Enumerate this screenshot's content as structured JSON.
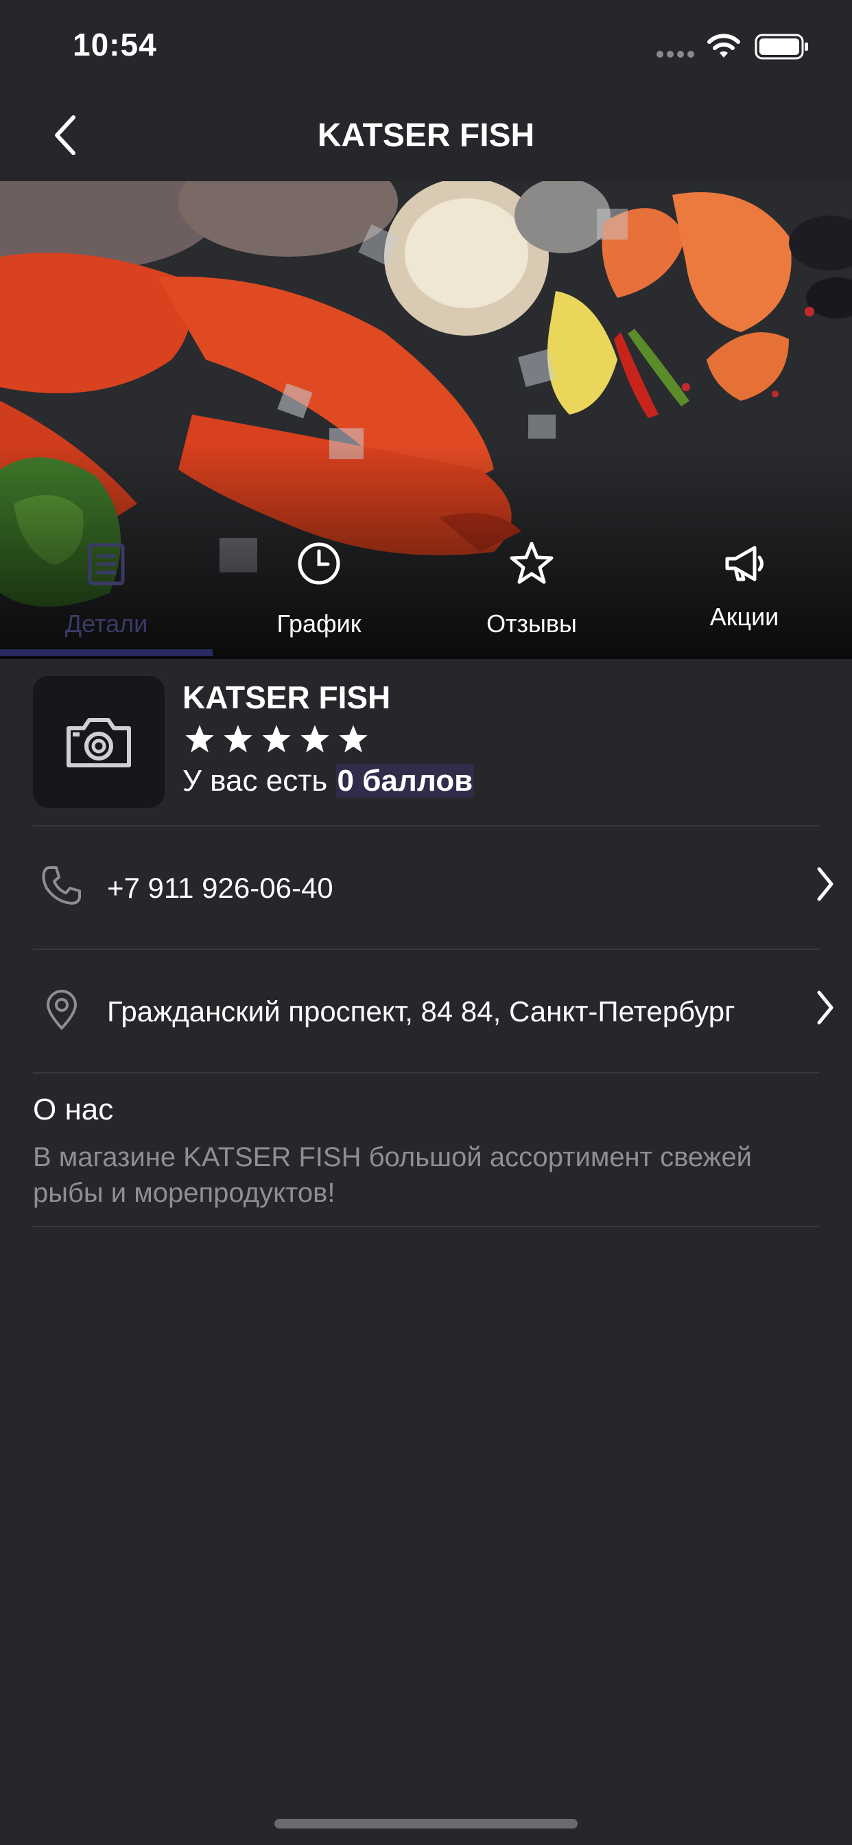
{
  "status_bar": {
    "time": "10:54"
  },
  "nav": {
    "title": "KATSER FISH"
  },
  "tabs": [
    {
      "label": "Детали",
      "icon": "details-icon",
      "active": true
    },
    {
      "label": "График",
      "icon": "clock-icon",
      "active": false
    },
    {
      "label": "Отзывы",
      "icon": "star-outline-icon",
      "active": false
    },
    {
      "label": "Акции",
      "icon": "megaphone-icon",
      "active": false
    }
  ],
  "shop": {
    "name": "KATSER FISH",
    "rating_stars": 5,
    "points_prefix": "У вас есть",
    "points_value": "0 баллов"
  },
  "contacts": {
    "phone": "+7 911 926-06-40",
    "address": "Гражданский проспект, 84 84, Санкт-Петербург"
  },
  "about": {
    "title": "О нас",
    "text": "В магазине KATSER FISH большой ассортимент свежей рыбы и морепродуктов!"
  },
  "colors": {
    "background": "#26262b",
    "accent": "#2a2960",
    "muted_text": "#8e8e96"
  }
}
